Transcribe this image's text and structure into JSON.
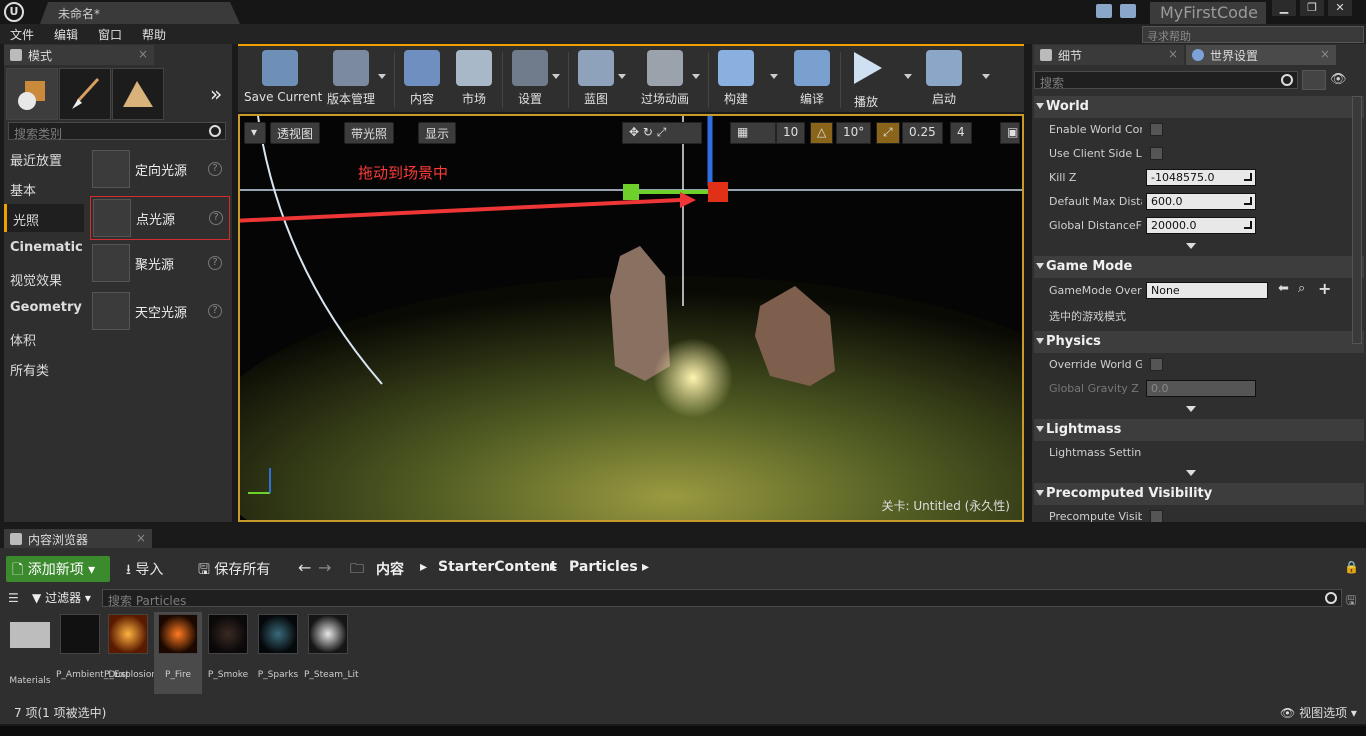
{
  "titlebar": {
    "doc_tab": "未命名*",
    "project": "MyFirstCode",
    "help_search_placeholder": "寻求帮助"
  },
  "menu": [
    "文件",
    "编辑",
    "窗口",
    "帮助"
  ],
  "modes_panel": {
    "title": "模式",
    "search_placeholder": "搜索类别",
    "categories": [
      "最近放置",
      "基本",
      "光照",
      "Cinematic",
      "视觉效果",
      "Geometry",
      "体积",
      "所有类"
    ],
    "selected_category": "光照",
    "lights": [
      "定向光源",
      "点光源",
      "聚光源",
      "天空光源"
    ]
  },
  "toolbar": {
    "buttons": [
      "Save Current",
      "版本管理",
      "内容",
      "市场",
      "设置",
      "蓝图",
      "过场动画",
      "构建",
      "编译",
      "播放",
      "启动"
    ]
  },
  "viewport": {
    "perspective": "透视图",
    "lit": "带光照",
    "show": "显示",
    "grid_snap": "10",
    "rot_snap": "10°",
    "scale_snap": "0.25",
    "cam_speed": "4",
    "annotation": "拖动到场景中",
    "level_prefix": "关卡:",
    "level_name": "Untitled (永久性)",
    "annotation_color": "#ff3a3a"
  },
  "details": {
    "tab1": "细节",
    "tab2": "世界设置",
    "search_placeholder": "搜索",
    "sections": {
      "world": "World",
      "game_mode": "Game Mode",
      "physics": "Physics",
      "lightmass": "Lightmass",
      "precomputed": "Precomputed Visibility"
    },
    "world_rows": {
      "enable_world_comp": "Enable World Comp",
      "use_client_side": "Use Client Side Le",
      "kill_z_label": "Kill Z",
      "kill_z": "-1048575.0",
      "default_max_label": "Default Max Distar",
      "default_max": "600.0",
      "global_df_label": "Global DistanceFie",
      "global_df": "20000.0"
    },
    "game_mode_rows": {
      "override_label": "GameMode Overri",
      "override_value": "None",
      "selected_mode": "选中的游戏模式"
    },
    "physics_rows": {
      "override_gravity": "Override World Gra",
      "global_gravity_label": "Global Gravity Z",
      "global_gravity": "0.0"
    },
    "lightmass_rows": {
      "settings": "Lightmass Setting"
    },
    "precomputed_rows": {
      "precompute": "Precompute Visibi"
    }
  },
  "content_browser": {
    "title": "内容浏览器",
    "add_new": "添加新项",
    "import": "导入",
    "save_all": "保存所有",
    "breadcrumb": [
      "内容",
      "StarterContent",
      "Particles"
    ],
    "filter": "过滤器",
    "search_placeholder": "搜索 Particles",
    "assets": [
      "Materials",
      "P_Ambient_Dust",
      "P_Explosion",
      "P_Fire",
      "P_Smoke",
      "P_Sparks",
      "P_Steam_Lit"
    ],
    "selected_asset": "P_Fire",
    "status": "7 项(1 项被选中)",
    "view_options": "视图选项"
  }
}
